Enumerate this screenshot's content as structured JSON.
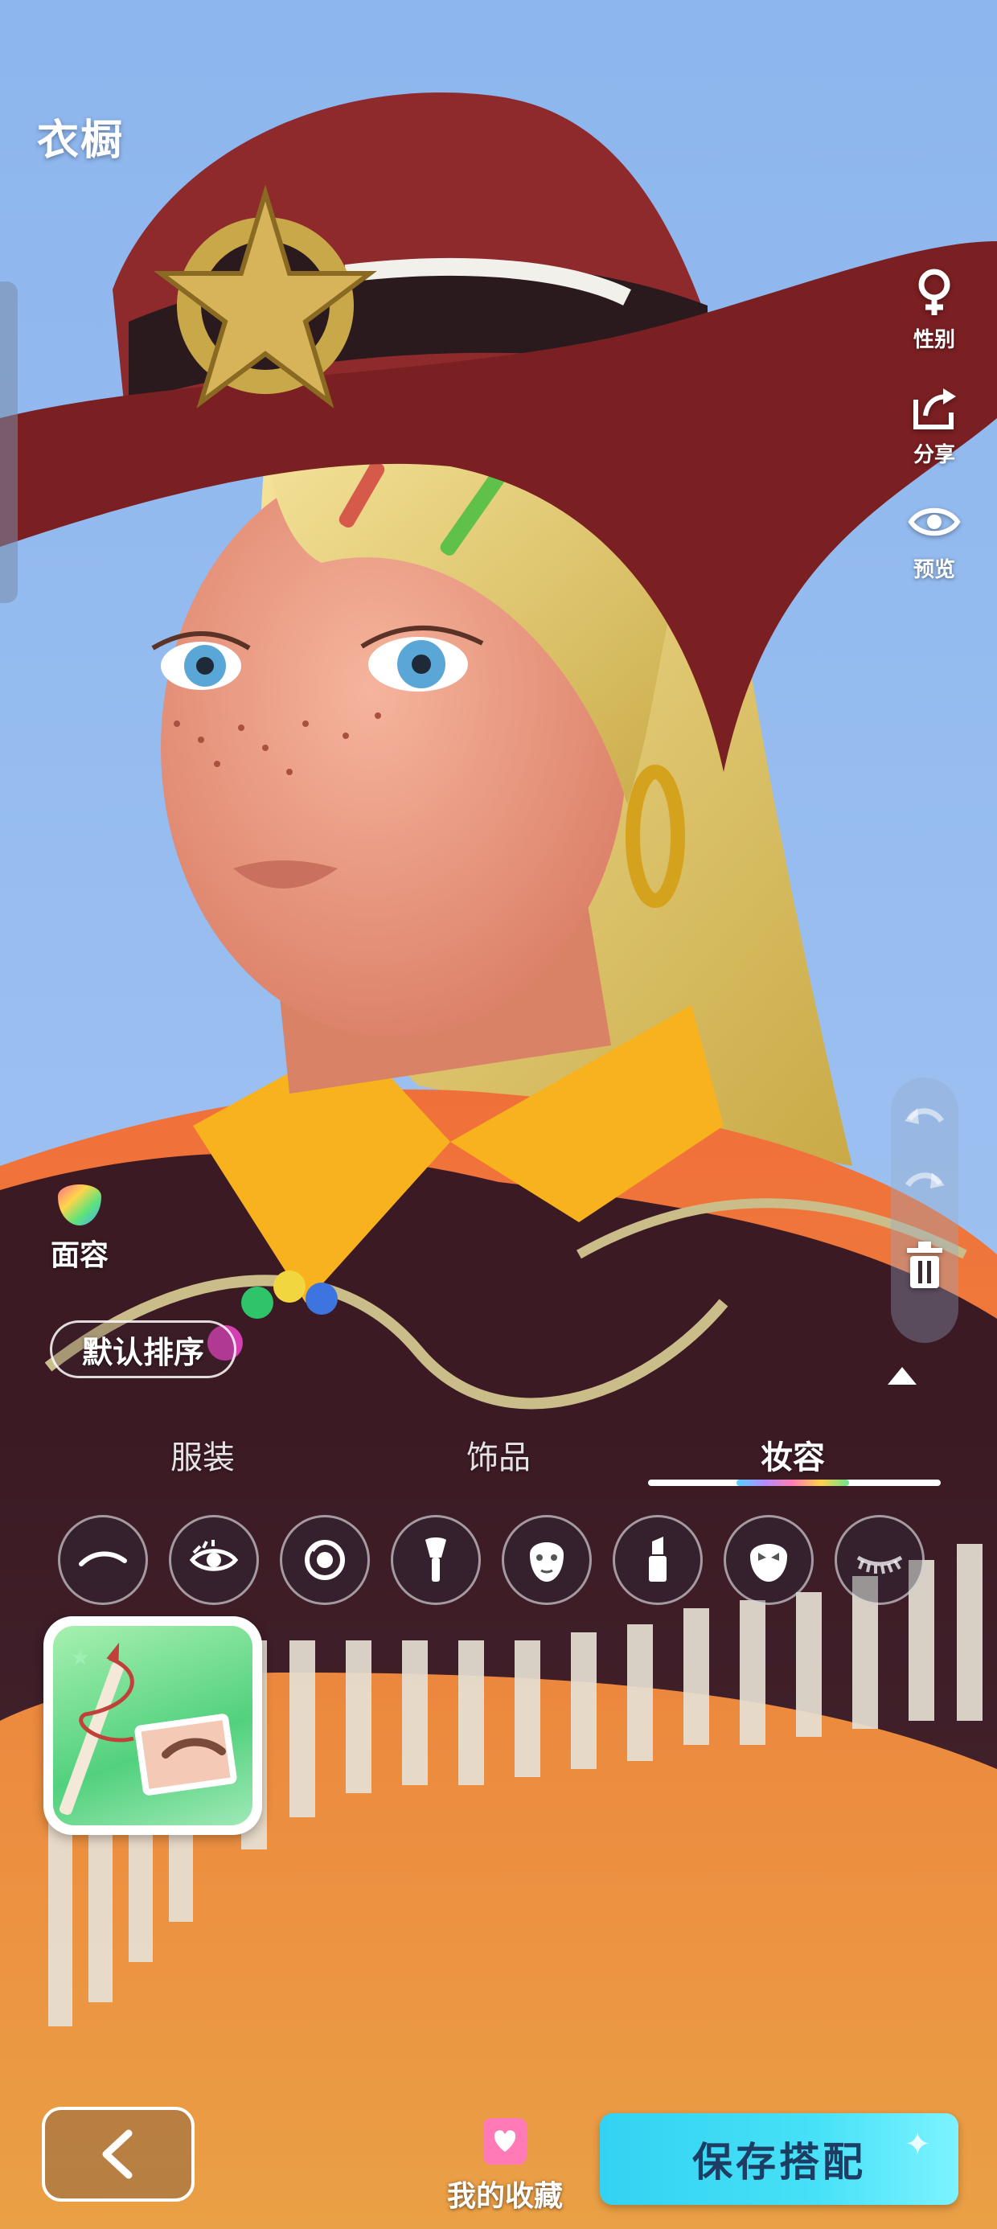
{
  "header": {
    "title": "衣橱"
  },
  "right_tools": [
    {
      "id": "gender",
      "label": "性别",
      "icon": "female-icon"
    },
    {
      "id": "share",
      "label": "分享",
      "icon": "share-icon"
    },
    {
      "id": "preview",
      "label": "预览",
      "icon": "eye-icon"
    }
  ],
  "history": {
    "undo_icon": "undo-icon",
    "redo_icon": "redo-icon",
    "delete_icon": "trash-icon"
  },
  "face": {
    "label": "面容",
    "icon": "rainbow-face-icon"
  },
  "sort": {
    "label": "默认排序"
  },
  "tabs": [
    {
      "label": "服装",
      "active": false
    },
    {
      "label": "饰品",
      "active": false
    },
    {
      "label": "妆容",
      "active": true
    }
  ],
  "makeup_categories": [
    {
      "icon": "eyebrow-icon",
      "selected": true
    },
    {
      "icon": "eye-icon"
    },
    {
      "icon": "eye-contact-lens-icon"
    },
    {
      "icon": "blush-brush-icon"
    },
    {
      "icon": "face-base-icon"
    },
    {
      "icon": "lipstick-icon"
    },
    {
      "icon": "face-paint-icon"
    },
    {
      "icon": "eyelash-icon"
    }
  ],
  "items": [
    {
      "icon": "eyebrow-pencil-icon",
      "selected": true
    }
  ],
  "footer": {
    "back_icon": "back-arrow-icon",
    "favorites_label": "我的收藏",
    "favorites_icon": "heart-bookmark-icon",
    "save_label": "保存搭配"
  },
  "colors": {
    "sky": "#8fb9ee",
    "save_button": "#46e1f7",
    "save_text": "#1e3d63",
    "hat": "#7a1f22",
    "hair": "#e9d37c",
    "collar": "#f8b21e",
    "jacket": "#3b1a24"
  }
}
